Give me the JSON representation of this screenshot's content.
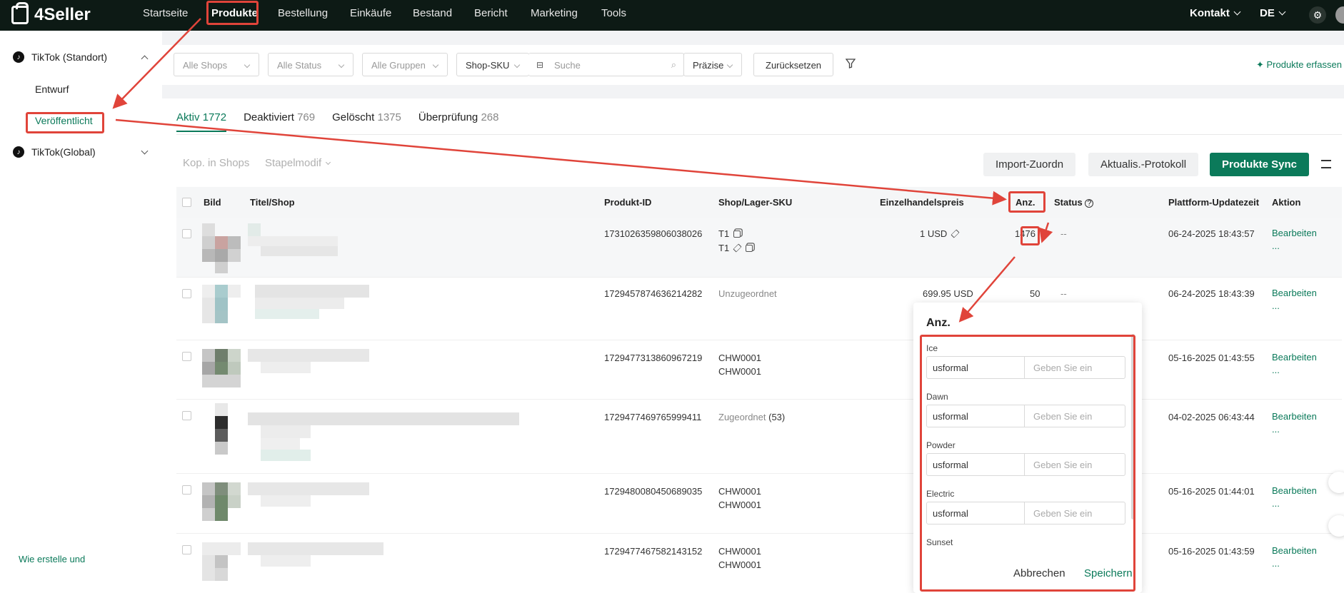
{
  "app": {
    "brand": "4Seller"
  },
  "nav": {
    "items": [
      "Startseite",
      "Produkte",
      "Bestellung",
      "Einkäufe",
      "Bestand",
      "Bericht",
      "Marketing",
      "Tools"
    ],
    "contact": "Kontakt",
    "language": "DE"
  },
  "sidebar": {
    "group1": "TikTok (Standort)",
    "draft": "Entwurf",
    "published": "Veröffentlicht",
    "group2": "TikTok(Global)",
    "help": "Wie erstelle und"
  },
  "filters": {
    "shops": "Alle Shops",
    "status": "Alle Status",
    "groups": "Alle Gruppen",
    "search_field": "Shop-SKU",
    "search_placeholder": "Suche",
    "match": "Präzise",
    "reset": "Zurücksetzen",
    "collect": "Produkte erfassen"
  },
  "tabs": [
    {
      "label": "Aktiv",
      "count": "1772"
    },
    {
      "label": "Deaktiviert",
      "count": "769"
    },
    {
      "label": "Gelöscht",
      "count": "1375"
    },
    {
      "label": "Überprüfung",
      "count": "268"
    }
  ],
  "toolbar": {
    "copy_shops": "Kop. in Shops",
    "batch": "Stapelmodif",
    "import": "Import-Zuordn",
    "log": "Aktualis.-Protokoll",
    "sync": "Produkte Sync"
  },
  "table": {
    "headers": {
      "image": "Bild",
      "title": "Titel/Shop",
      "product_id": "Produkt-ID",
      "sku": "Shop/Lager-SKU",
      "price": "Einzelhandelspreis",
      "qty": "Anz.",
      "status": "Status",
      "updated": "Plattform-Updatezeit",
      "action": "Aktion"
    },
    "rows": [
      {
        "product_id": "1731026359806038026",
        "sku1": "T1",
        "sku2": "T1",
        "price": "1 USD",
        "qty": "1476",
        "status": "--",
        "updated": "06-24-2025 18:43:57",
        "action": "Bearbeiten",
        "more": "..."
      },
      {
        "product_id": "1729457874636214282",
        "sku1": "Unzugeordnet",
        "sku2": "",
        "price": "699.95 USD",
        "qty": "50",
        "status": "--",
        "updated": "06-24-2025 18:43:39",
        "action": "Bearbeiten",
        "more": "..."
      },
      {
        "product_id": "1729477313860967219",
        "sku1": "CHW0001",
        "sku2": "CHW0001",
        "price": "",
        "qty": "",
        "status": "",
        "updated": "05-16-2025 01:43:55",
        "action": "Bearbeiten",
        "more": "..."
      },
      {
        "product_id": "1729477469765999411",
        "sku1": "Zugeordnet",
        "sku1_count": "(53)",
        "sku2": "",
        "price": "",
        "qty": "",
        "status": "",
        "updated": "04-02-2025 06:43:44",
        "action": "Bearbeiten",
        "more": "..."
      },
      {
        "product_id": "1729480080450689035",
        "sku1": "CHW0001",
        "sku2": "CHW0001",
        "price": "",
        "qty": "",
        "status": "",
        "updated": "05-16-2025 01:44:01",
        "action": "Bearbeiten",
        "more": "..."
      },
      {
        "product_id": "1729477467582143152",
        "sku1": "CHW0001",
        "sku2": "CHW0001",
        "price": "",
        "qty": "",
        "status": "",
        "updated": "05-16-2025 01:43:59",
        "action": "Bearbeiten",
        "more": "..."
      }
    ]
  },
  "popover": {
    "title": "Anz.",
    "variants": [
      {
        "label": "Ice",
        "warehouse": "usformal",
        "placeholder": "Geben Sie ein"
      },
      {
        "label": "Dawn",
        "warehouse": "usformal",
        "placeholder": "Geben Sie ein"
      },
      {
        "label": "Powder",
        "warehouse": "usformal",
        "placeholder": "Geben Sie ein"
      },
      {
        "label": "Electric",
        "warehouse": "usformal",
        "placeholder": "Geben Sie ein"
      },
      {
        "label": "Sunset"
      }
    ],
    "cancel": "Abbrechen",
    "save": "Speichern"
  },
  "colors": {
    "accent": "#0b7a5a",
    "annotation": "#e0443a",
    "nav_bg": "#0d1a15"
  }
}
